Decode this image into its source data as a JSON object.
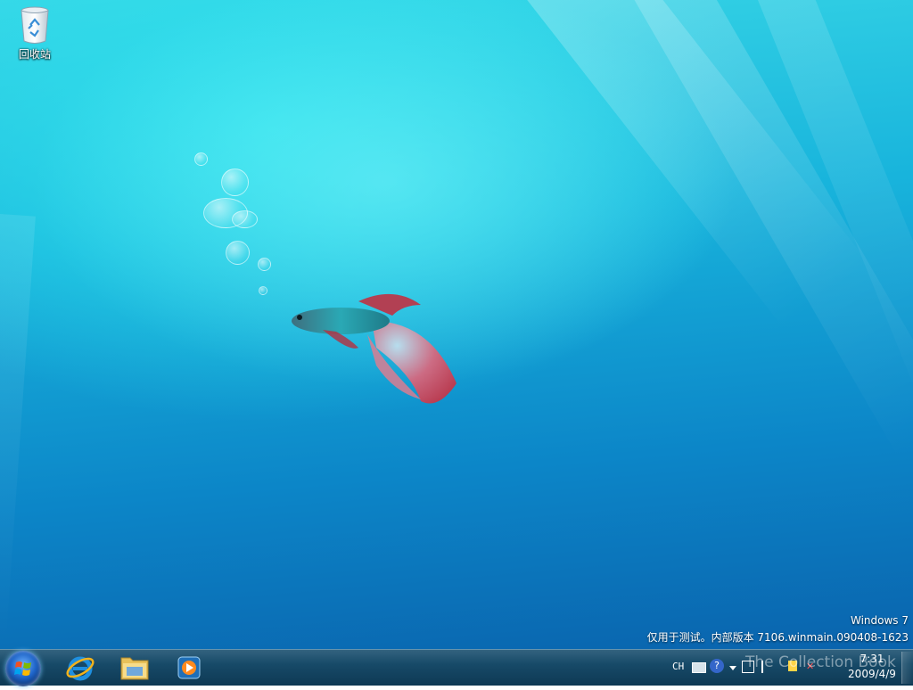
{
  "desktop": {
    "icons": [
      {
        "label": "回收站",
        "icon": "recycle-bin-icon"
      }
    ],
    "watermark": {
      "line1": "Windows 7",
      "line2": "仅用于测试。内部版本 7106.winmain.090408-1623"
    }
  },
  "taskbar": {
    "start_icon": "windows-orb-icon",
    "pinned": [
      {
        "name": "internet-explorer",
        "icon": "internet-explorer-icon"
      },
      {
        "name": "windows-explorer",
        "icon": "folder-icon"
      },
      {
        "name": "media-player",
        "icon": "media-player-icon"
      }
    ],
    "tray": {
      "language": "CH",
      "icons": [
        "keyboard-icon",
        "help-icon",
        "overflow-arrow-icon",
        "network-icon",
        "flag-icon",
        "volume-muted-icon"
      ],
      "time": "7:31",
      "date": "2009/4/9"
    }
  },
  "overlay_watermark": "The Collection Book",
  "colors": {
    "taskbar": "#174a68",
    "desktop_top": "#37d6e6",
    "desktop_bottom": "#0a63ad"
  }
}
